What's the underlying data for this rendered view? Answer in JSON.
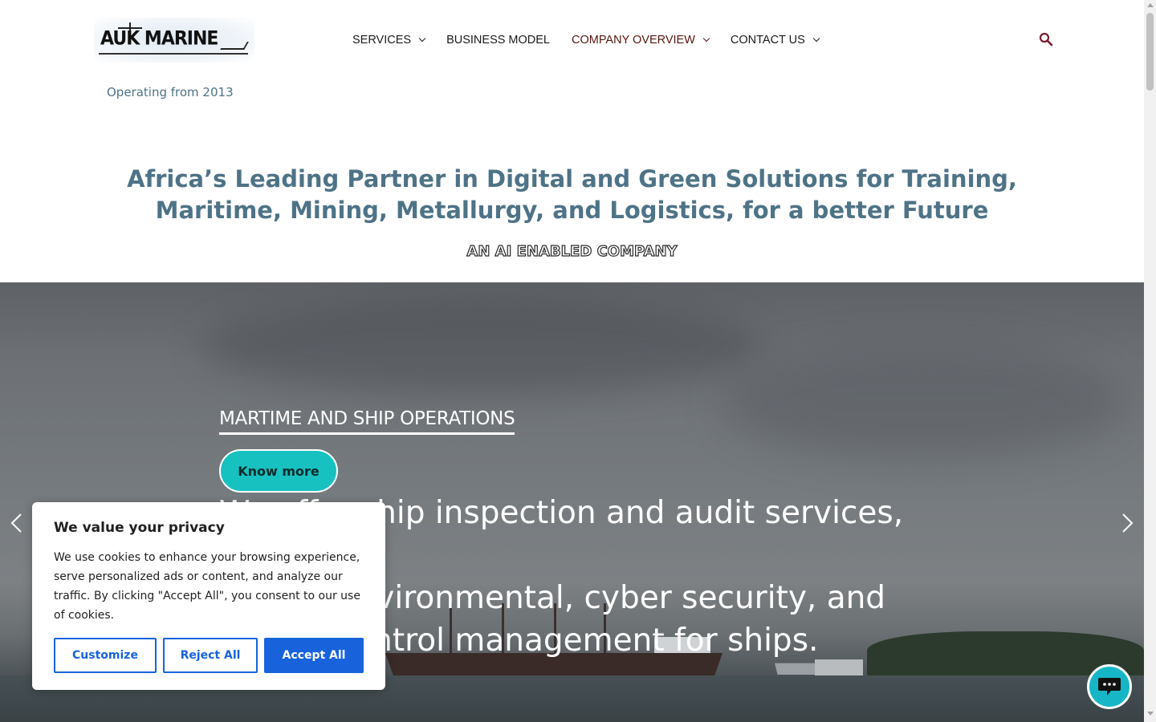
{
  "logo": {
    "text": "AUK MARINE"
  },
  "tagline": "Operating from 2013",
  "nav": {
    "items": [
      {
        "label": "SERVICES",
        "has_dropdown": true
      },
      {
        "label": "BUSINESS MODEL",
        "has_dropdown": false
      },
      {
        "label": "COMPANY OVERVIEW",
        "has_dropdown": true,
        "active": true
      },
      {
        "label": "CONTACT US",
        "has_dropdown": true
      }
    ],
    "search_icon": "search-icon"
  },
  "hero_heading": {
    "line1": "Africa’s Leading Partner in Digital and Green Solutions for Training,",
    "line2": "Maritime, Mining, Metallurgy, and Logistics, for a better Future",
    "subtitle": "AN AI ENABLED COMPANY"
  },
  "slider": {
    "title": "MARTIME AND SHIP OPERATIONS",
    "button_label": "Know more",
    "text_line1": "We offer ship inspection and audit services, as",
    "text_line2": "well as environmental, cyber security, and",
    "text_line3": "quality control management for ships.",
    "prev_icon": "chevron-left-icon",
    "next_icon": "chevron-right-icon"
  },
  "cookie": {
    "title": "We value your privacy",
    "body": "We use cookies to enhance your browsing experience, serve personalized ads or content, and analyze our traffic. By clicking \"Accept All\", you consent to our use of cookies.",
    "customize_label": "Customize",
    "reject_label": "Reject All",
    "accept_label": "Accept All"
  },
  "chat": {
    "icon": "chat-icon"
  },
  "colors": {
    "heading": "#4e7387",
    "active_nav": "#5b1414",
    "button_teal": "#16c1c0",
    "cookie_blue": "#1863dc"
  }
}
